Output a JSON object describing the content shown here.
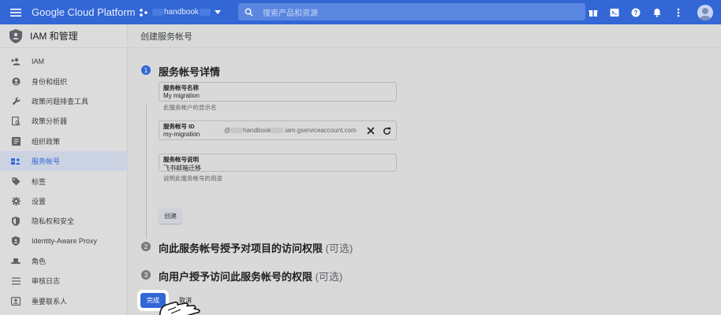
{
  "header": {
    "brand": "Google Cloud Platform",
    "project_name": "handbook",
    "search_placeholder": "搜索产品和资源"
  },
  "sidebar": {
    "title": "IAM 和管理",
    "items": [
      {
        "label": "IAM",
        "icon": "person-add-icon"
      },
      {
        "label": "身份和组织",
        "icon": "account-circle-icon"
      },
      {
        "label": "政策问题排查工具",
        "icon": "wrench-icon"
      },
      {
        "label": "政策分析器",
        "icon": "document-search-icon"
      },
      {
        "label": "组织政策",
        "icon": "list-box-icon"
      },
      {
        "label": "服务帐号",
        "icon": "service-account-icon",
        "active": true
      },
      {
        "label": "标签",
        "icon": "tag-icon"
      },
      {
        "label": "设置",
        "icon": "gear-icon"
      },
      {
        "label": "隐私权和安全",
        "icon": "shield-icon"
      },
      {
        "label": "Identity-Aware Proxy",
        "icon": "proxy-shield-icon"
      },
      {
        "label": "角色",
        "icon": "hat-icon"
      },
      {
        "label": "审核日志",
        "icon": "list-icon"
      },
      {
        "label": "重要联系人",
        "icon": "contact-card-icon"
      }
    ]
  },
  "main": {
    "page_title": "创建服务帐号",
    "step1": {
      "number": "1",
      "title": "服务帐号详情",
      "name_label": "服务帐号名称",
      "name_value": "My migration",
      "name_hint": "此服务帐户的显示名",
      "id_label": "服务帐号 ID",
      "id_value": "my-migration",
      "id_suffix_at": "@",
      "id_suffix_project": "handbook",
      "id_suffix_domain": ".iam.gserviceaccount.com",
      "desc_label": "服务帐号说明",
      "desc_value": "飞书邮箱迁移",
      "desc_hint": "说明此服务帐号的用途",
      "create_button": "创建"
    },
    "step2": {
      "number": "2",
      "title": "向此服务帐号授予对项目的访问权限",
      "optional": "(可选)"
    },
    "step3": {
      "number": "3",
      "title": "向用户授予访问此服务帐号的权限",
      "optional": "(可选)"
    },
    "done_button": "完成",
    "cancel_button": "取消"
  },
  "colors": {
    "accent": "#3367d6",
    "active_bg": "#cbd3e3",
    "background": "#d9d9d9"
  }
}
